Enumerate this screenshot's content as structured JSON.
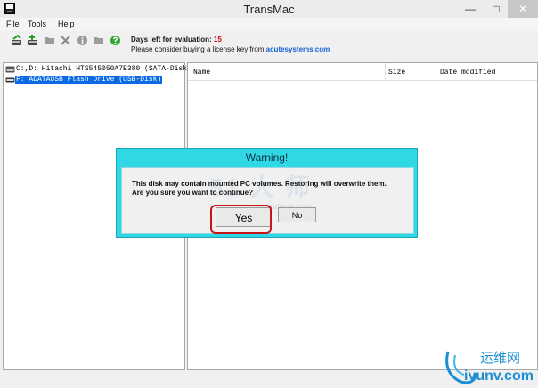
{
  "window": {
    "title": "TransMac",
    "minimize_glyph": "—",
    "maximize_glyph": "□",
    "close_glyph": "✕"
  },
  "menu": [
    "File",
    "Tools",
    "Help"
  ],
  "toolbar": {
    "icons": [
      "open-disk-icon",
      "add-disk-icon",
      "new-folder-icon",
      "delete-icon",
      "info-icon",
      "folder-icon",
      "help-icon"
    ],
    "eval_label": "Days left for evaluation:",
    "eval_days": "15",
    "license_prefix": "Please consider buying a license key from",
    "license_link": "acutesystems.com"
  },
  "drives": [
    {
      "label": "C:,D: Hitachi HTS545050A7E380 (SATA-Disk)",
      "selected": false,
      "icon": "hard-disk-icon"
    },
    {
      "label": "F: ADATAUSB Flash Drive (USB-Disk)",
      "selected": true,
      "icon": "usb-disk-icon"
    }
  ],
  "file_list": {
    "columns": [
      "Name",
      "Size",
      "Date modified"
    ]
  },
  "dialog": {
    "title": "Warning!",
    "message_line1": "This disk may contain mounted PC volumes. Restoring will overwrite them.",
    "message_line2": "Are you sure you want to continue?",
    "yes_label": "Yes",
    "no_label": "No",
    "watermark_text": "51 大 师",
    "watermark_url": "www.udaxia.com"
  },
  "site_watermark": {
    "name": "运维网",
    "url": "iyunv.com"
  },
  "colors": {
    "dialog_bg": "#30d8e6",
    "selection": "#0a6ae3",
    "eval_count": "#d00000",
    "highlight": "#c8141b"
  }
}
